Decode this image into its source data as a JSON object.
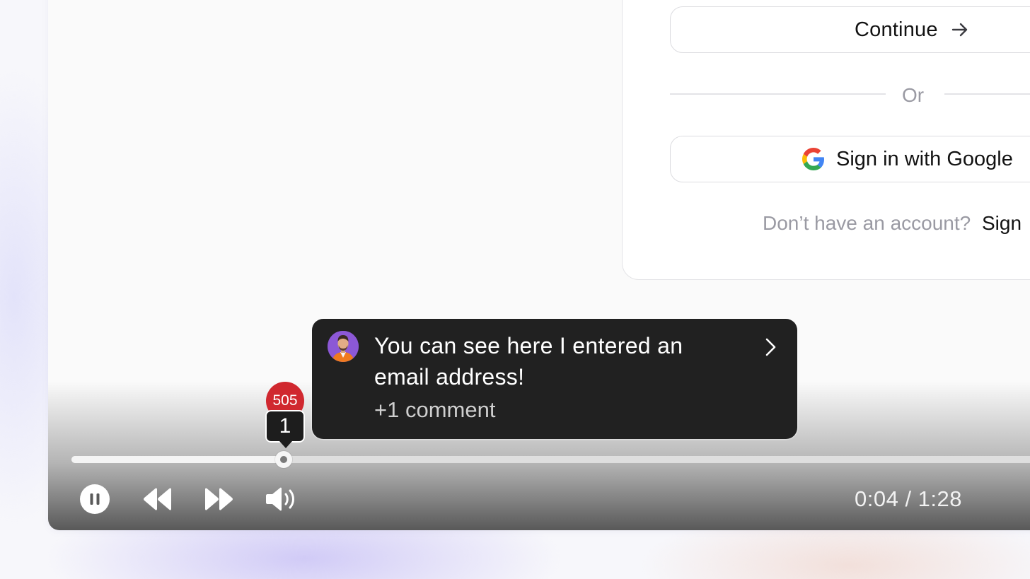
{
  "login": {
    "continue_label": "Continue",
    "divider_label": "Or",
    "google_label": "Sign in with Google",
    "signup_question": "Don’t have an account?",
    "signup_link": "Sign"
  },
  "player": {
    "progress_fraction": 0.0454,
    "marker_count_red": "505",
    "marker_count_dark": "1",
    "time_display": "0:04 / 1:28",
    "comment": {
      "text": "You can see here I entered an email address!",
      "more": "+1 comment"
    }
  },
  "icons": {
    "continue_icon": "arrow-right-icon",
    "google_icon": "google-g-icon",
    "comment_icon": "chevron-right-icon",
    "controls": [
      "pause-icon",
      "rewind-icon",
      "fast-forward-icon",
      "volume-icon"
    ]
  },
  "colors": {
    "badge_red": "#d0282f",
    "comment_bg": "#212121",
    "avatar_bg": "#8c58d6"
  }
}
